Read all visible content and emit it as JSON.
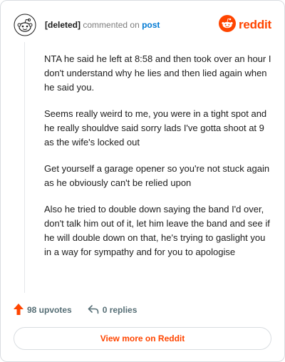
{
  "header": {
    "author": "[deleted]",
    "action": "commented on",
    "target": "post",
    "brand_name": "reddit",
    "avatar_icon": "deleted-user-avatar-icon",
    "brand_icon": "reddit-logo-icon",
    "brand_color": "#ff4500",
    "link_color": "#0079d3"
  },
  "comment": {
    "paragraphs": [
      "NTA he said he left at 8:58 and then took over an hour I don't understand why he lies and then lied again when he said you.",
      "Seems really weird to me, you were in a tight spot and he really shouldve said sorry lads I've gotta shoot at 9 as the wife's locked out",
      "Get yourself a garage opener so you're not stuck again as he obviously can't be relied upon",
      "Also he tried to double down saying the band I'd over, don't talk him out of it, let him leave the band and see if he will double down on that, he's trying to gaslight you in a way for sympathy and for you to apologise"
    ]
  },
  "footer": {
    "upvotes": "98 upvotes",
    "replies": "0 replies",
    "upvote_icon": "upvote-arrow-icon",
    "reply_icon": "reply-arrow-icon"
  },
  "cta": {
    "label": "View more on Reddit"
  }
}
